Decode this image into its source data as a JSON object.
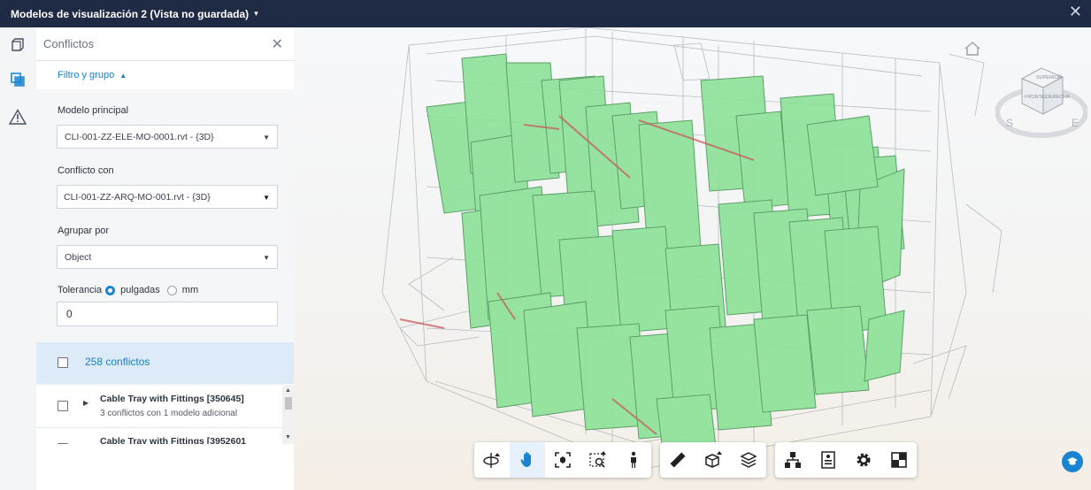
{
  "topbar": {
    "title": "Modelos de visualización 2 (Vista no guardada)",
    "caret": "▾",
    "close": "✕"
  },
  "rail": {
    "icons": [
      "cube-outline-icon",
      "clash-icon",
      "warning-icon"
    ]
  },
  "panel": {
    "title": "Conflictos",
    "close": "✕",
    "filter": {
      "label": "Filtro y grupo",
      "icon": "▲"
    },
    "principal": {
      "label": "Modelo principal",
      "value": "CLI-001-ZZ-ELE-MO-0001.rvt - {3D}"
    },
    "conflict_with": {
      "label": "Conflicto con",
      "value": "CLI-001-ZZ-ARQ-MO-001.rvt - {3D}"
    },
    "group_by": {
      "label": "Agrupar por",
      "value": "Object"
    },
    "tolerance": {
      "label": "Tolerancia",
      "opt1": "pulgadas",
      "opt2": "mm",
      "selected": "pulgadas",
      "value": "0"
    },
    "count_label": "258 conflictos",
    "items": [
      {
        "name": "Cable Tray with Fittings [350645]",
        "sub": "3 conflictos con 1 modelo adicional"
      },
      {
        "name": "Cable Tray with Fittings [3952601",
        "sub": ""
      }
    ]
  },
  "toolbar": {
    "group1": [
      "orbit-icon",
      "pan-icon",
      "fit-to-view-icon",
      "zoom-window-icon",
      "first-person-icon"
    ],
    "group2": [
      "measure-icon",
      "section-analysis-icon",
      "layers-icon"
    ],
    "group3": [
      "model-browser-icon",
      "properties-icon",
      "settings-icon",
      "fullscreen-icon"
    ],
    "active": "pan-icon"
  },
  "viewcube": {
    "top": "SUPERIOR",
    "front": "FRONTAL",
    "right": "DERECHA",
    "s": "S",
    "e": "E"
  },
  "colors": {
    "clash_green": "#8fe29a",
    "clash_edge": "#4f9a5c",
    "accent": "#1b84d0",
    "topbar": "#1f2a44"
  }
}
